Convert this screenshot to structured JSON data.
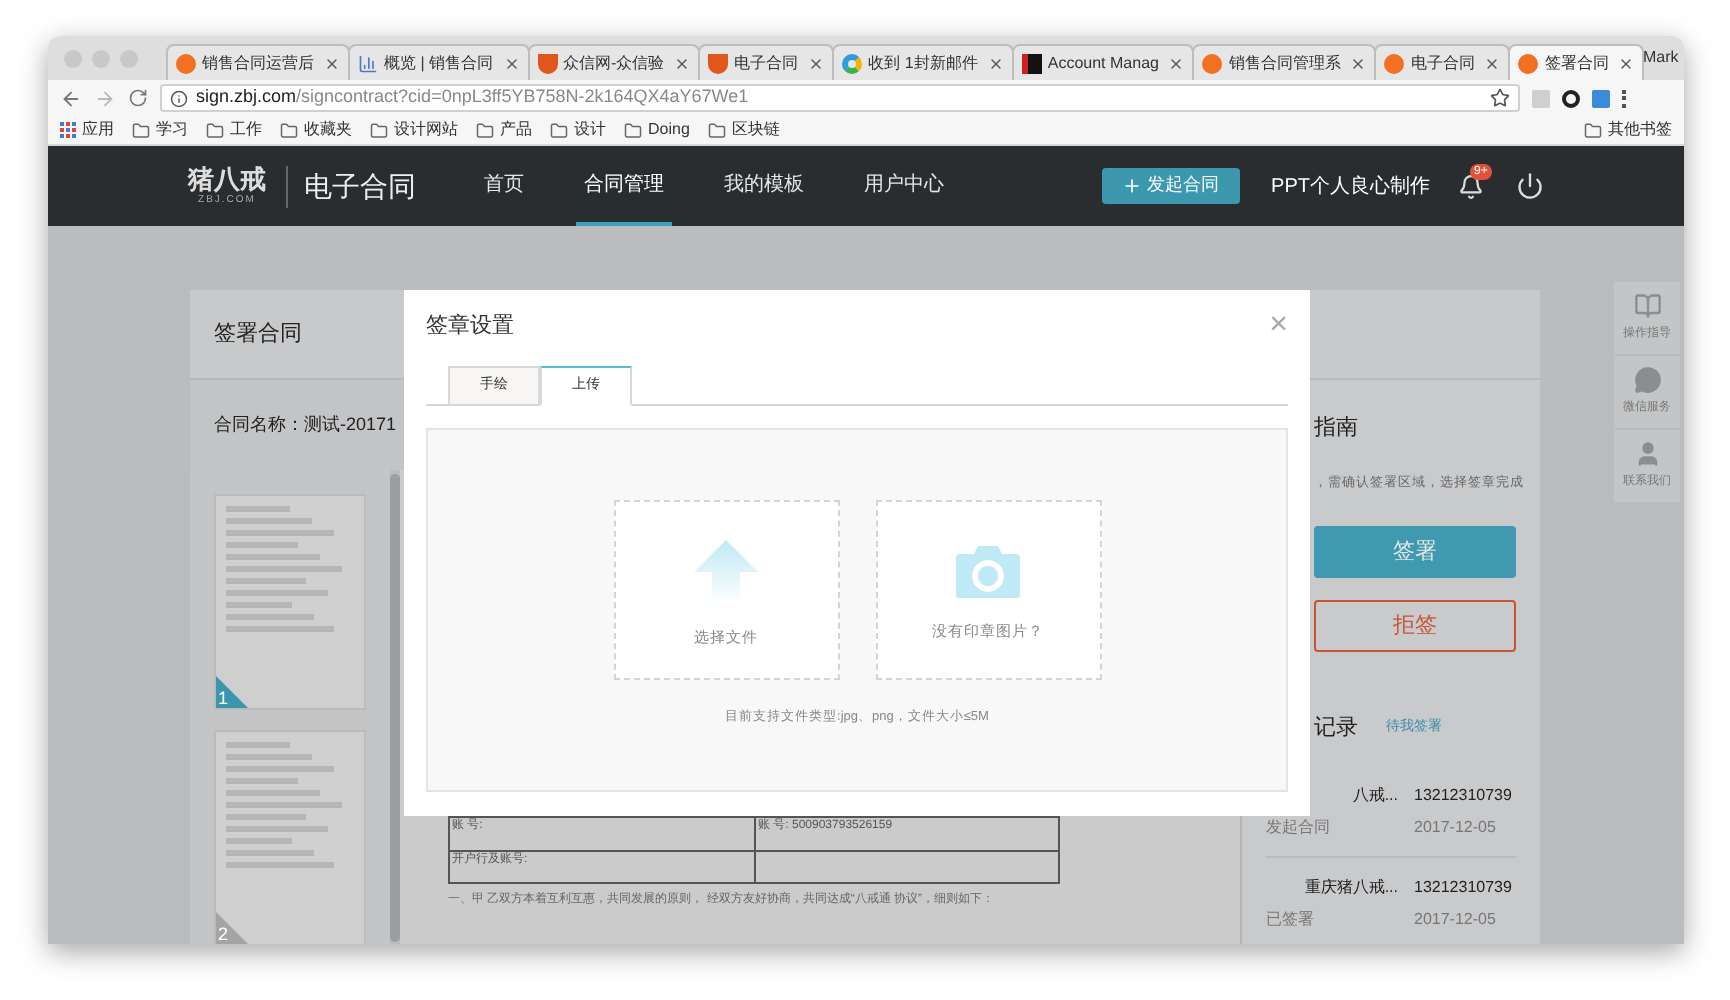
{
  "browser": {
    "tabs": [
      {
        "title": "销售合同运营后",
        "kind": "zbj",
        "selected": false
      },
      {
        "title": "概览 | 销售合同",
        "kind": "chart",
        "selected": false
      },
      {
        "title": "众信网-众信验",
        "kind": "badge",
        "selected": false
      },
      {
        "title": "电子合同",
        "kind": "badge",
        "selected": false
      },
      {
        "title": "收到 1封新邮件",
        "kind": "ring",
        "selected": false
      },
      {
        "title": "Account Manag",
        "kind": "dark",
        "selected": false
      },
      {
        "title": "销售合同管理系",
        "kind": "zbj",
        "selected": false
      },
      {
        "title": "电子合同",
        "kind": "zbj",
        "selected": false
      },
      {
        "title": "签署合同",
        "kind": "zbj",
        "selected": true
      }
    ],
    "profile": "Mark",
    "url_host": "sign.zbj.com",
    "url_path": "/signcontract?cid=0npL3ff5YB758N-2k164QX4aY67We1",
    "bookmarks": [
      {
        "label": "应用",
        "kind": "apps"
      },
      {
        "label": "学习",
        "kind": "folder"
      },
      {
        "label": "工作",
        "kind": "folder"
      },
      {
        "label": "收藏夹",
        "kind": "folder"
      },
      {
        "label": "设计网站",
        "kind": "folder"
      },
      {
        "label": "产品",
        "kind": "folder"
      },
      {
        "label": "设计",
        "kind": "folder"
      },
      {
        "label": "Doing",
        "kind": "folder"
      },
      {
        "label": "区块链",
        "kind": "folder"
      }
    ],
    "other_bookmarks": "其他书签"
  },
  "header": {
    "logo": "猪八戒",
    "logo_sub": "ZBJ.COM",
    "product": "电子合同",
    "nav": [
      {
        "label": "首页",
        "selected": false
      },
      {
        "label": "合同管理",
        "selected": true
      },
      {
        "label": "我的模板",
        "selected": false
      },
      {
        "label": "用户中心",
        "selected": false
      }
    ],
    "create_button": "发起合同",
    "user": "PPT个人良心制作",
    "badge": "9+"
  },
  "page": {
    "title": "签署合同",
    "contract_name": "合同名称：测试-20171",
    "thumbnails": [
      {
        "number": "1",
        "selected": true
      },
      {
        "number": "2",
        "selected": false
      }
    ],
    "document": {
      "rows": [
        [
          "账 号:",
          "账 号: 500903793526159"
        ],
        [
          "开户行及账号:",
          ""
        ]
      ],
      "clause": "一、甲 乙双方本着互利互惠，共同发展的原则， 经双方友好协商，共同达成“八戒通 协议”，细则如下："
    },
    "guide_title": "指南",
    "guide_text": "，需确认签署区域，选择签章完成",
    "sign_button": "签署",
    "reject_button": "拒签",
    "records_title": "记录",
    "records_link": "待我签署",
    "records": [
      {
        "name": "八戒...",
        "phone": "13212310739",
        "action": "发起合同",
        "date": "2017-12-05"
      },
      {
        "name": "重庆猪八戒...",
        "phone": "13212310739",
        "action": "已签署",
        "date": "2017-12-05"
      }
    ]
  },
  "side_tools": [
    {
      "label": "操作指导",
      "kind": "book"
    },
    {
      "label": "微信服务",
      "kind": "wechat"
    },
    {
      "label": "联系我们",
      "kind": "qq"
    }
  ],
  "modal": {
    "title": "签章设置",
    "close": "×",
    "tabs": [
      {
        "label": "手绘",
        "selected": false
      },
      {
        "label": "上传",
        "selected": true
      }
    ],
    "options": [
      {
        "label": "选择文件",
        "kind": "upload"
      },
      {
        "label": "没有印章图片？",
        "kind": "camera"
      }
    ],
    "hint": "目前支持文件类型:jpg、png，文件大小≤5M"
  }
}
